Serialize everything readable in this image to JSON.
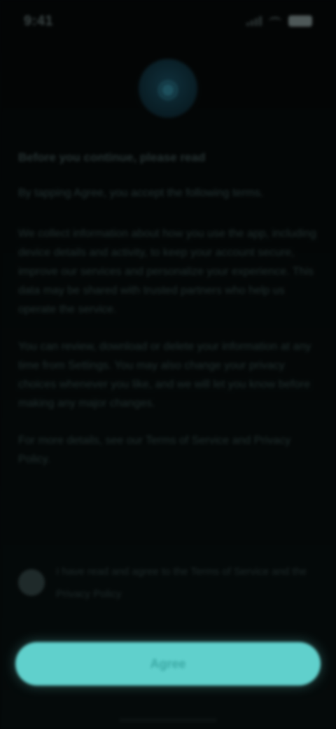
{
  "status_bar": {
    "time": "9:41"
  },
  "logo": {
    "icon": "shield-icon",
    "glyph": "◉"
  },
  "content": {
    "title": "Before you continue, please read",
    "subtitle": "By tapping Agree, you accept the following terms.",
    "paragraphs": [
      "We collect information about how you use the app, including device details and activity, to keep your account secure, improve our services and personalize your experience. This data may be shared with trusted partners who help us operate the service.",
      "You can review, download or delete your information at any time from Settings. You may also change your privacy choices whenever you like, and we will let you know before making any major changes.",
      "For more details, see our Terms of Service and Privacy Policy."
    ]
  },
  "consent": {
    "label": "I have read and agree to the Terms of Service and the Privacy Policy"
  },
  "cta": {
    "label": "Agree"
  },
  "colors": {
    "accent": "#60d0cc",
    "background": "#030607"
  }
}
